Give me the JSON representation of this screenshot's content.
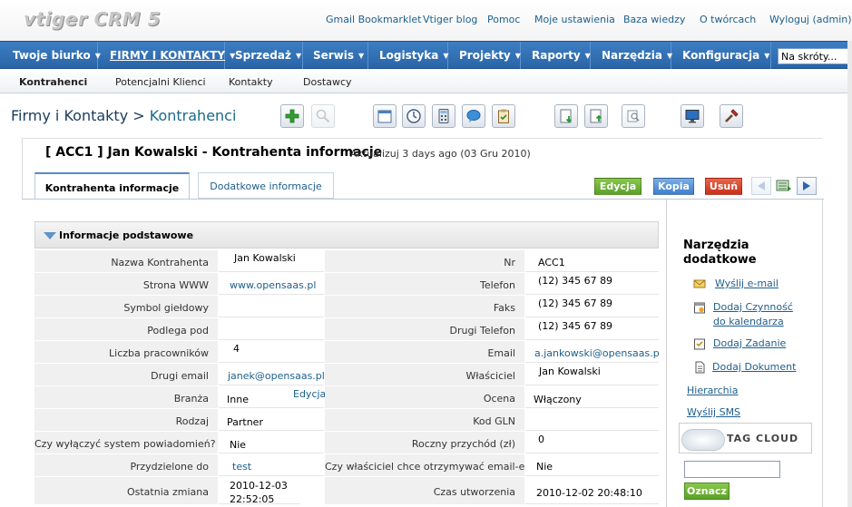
{
  "app": {
    "logo": "vtiger CRM 5"
  },
  "top_links": [
    "Gmail Bookmarklet",
    "Vtiger blog",
    "Pomoc",
    "Moje ustawienia",
    "Baza wiedzy",
    "O twórcach",
    "Wyloguj (admin)"
  ],
  "nav": {
    "items": [
      {
        "label": "Twoje biurko"
      },
      {
        "label": "FIRMY I KONTAKTY"
      },
      {
        "label": "Sprzedaż"
      },
      {
        "label": "Serwis"
      },
      {
        "label": "Logistyka"
      },
      {
        "label": "Projekty"
      },
      {
        "label": "Raporty"
      },
      {
        "label": "Narzędzia"
      },
      {
        "label": "Konfiguracja"
      }
    ],
    "shortcut_value": "Na skróty..."
  },
  "subnav": [
    "Kontrahenci",
    "Potencjalni Klienci",
    "Kontakty",
    "Dostawcy"
  ],
  "breadcrumb": {
    "module": "Firmy i Kontakty",
    "sep": ">",
    "page": "Kontrahenci"
  },
  "toolbar_icons": [
    "add-icon",
    "search-icon",
    "calendar-icon",
    "clock-icon",
    "calculator-icon",
    "chat-icon",
    "clipboard-icon",
    "import-icon",
    "export-icon",
    "find-duplicates-icon",
    "monitor-icon",
    "settings-icon"
  ],
  "record": {
    "title": "[ ACC1 ] Jan Kowalski -  Kontrahenta informacje",
    "updated": "Aktualizuj 3 days ago (03 Gru 2010)"
  },
  "tabs": [
    "Kontrahenta informacje",
    "Dodatkowe informacje"
  ],
  "actions": {
    "edit": "Edycja",
    "copy": "Kopia",
    "delete": "Usuń"
  },
  "section": {
    "title": "Informacje podstawowe",
    "inline_edit": "Edycja"
  },
  "fields": [
    {
      "l1": "Nazwa Kontrahenta",
      "v1": "Jan Kowalski",
      "l2": "Nr",
      "v2": "ACC1"
    },
    {
      "l1": "Strona WWW",
      "v1": "www.opensaas.pl",
      "l2": "Telefon",
      "v2": "(12) 345 67 89"
    },
    {
      "l1": "Symbol giełdowy",
      "v1": "",
      "l2": "Faks",
      "v2": "(12) 345 67 89"
    },
    {
      "l1": "Podlega pod",
      "v1": "",
      "l2": "Drugi Telefon",
      "v2": "(12) 345 67 89"
    },
    {
      "l1": "Liczba pracowników",
      "v1": "4",
      "l2": "Email",
      "v2": "a.jankowski@opensaas.pl"
    },
    {
      "l1": "Drugi email",
      "v1": "janek@opensaas.pl",
      "l2": "Właściciel",
      "v2": "Jan Kowalski"
    },
    {
      "l1": "Branża",
      "v1": "Inne",
      "l2": "Ocena",
      "v2": "Włączony"
    },
    {
      "l1": "Rodzaj",
      "v1": "Partner",
      "l2": "Kod GLN",
      "v2": ""
    },
    {
      "l1": "Czy wyłączyć system powiadomień?",
      "v1": "Nie",
      "l2": "Roczny przychód (zł)",
      "v2": "0"
    },
    {
      "l1": "Przydzielone do",
      "v1": "test",
      "l2": "Czy właściciel chce otrzymywać email-e",
      "v2": "Nie"
    },
    {
      "l1": "Ostatnia zmiana",
      "v1": "2010-12-03 22:52:05",
      "l2": "Czas utworzenia",
      "v2": "2010-12-02 20:48:10"
    }
  ],
  "tools": {
    "title": "Narzędzia dodatkowe",
    "send_email": "Wyślij e-mail",
    "add_event": "Dodaj Czynność do kalendarza",
    "add_task": "Dodaj Zadanie",
    "add_document": "Dodaj Dokument",
    "hierarchy": "Hierarchia",
    "send_sms": "Wyślij SMS"
  },
  "tagcloud": {
    "title": "TAG CLOUD",
    "input_value": "",
    "button": "Oznacz"
  }
}
